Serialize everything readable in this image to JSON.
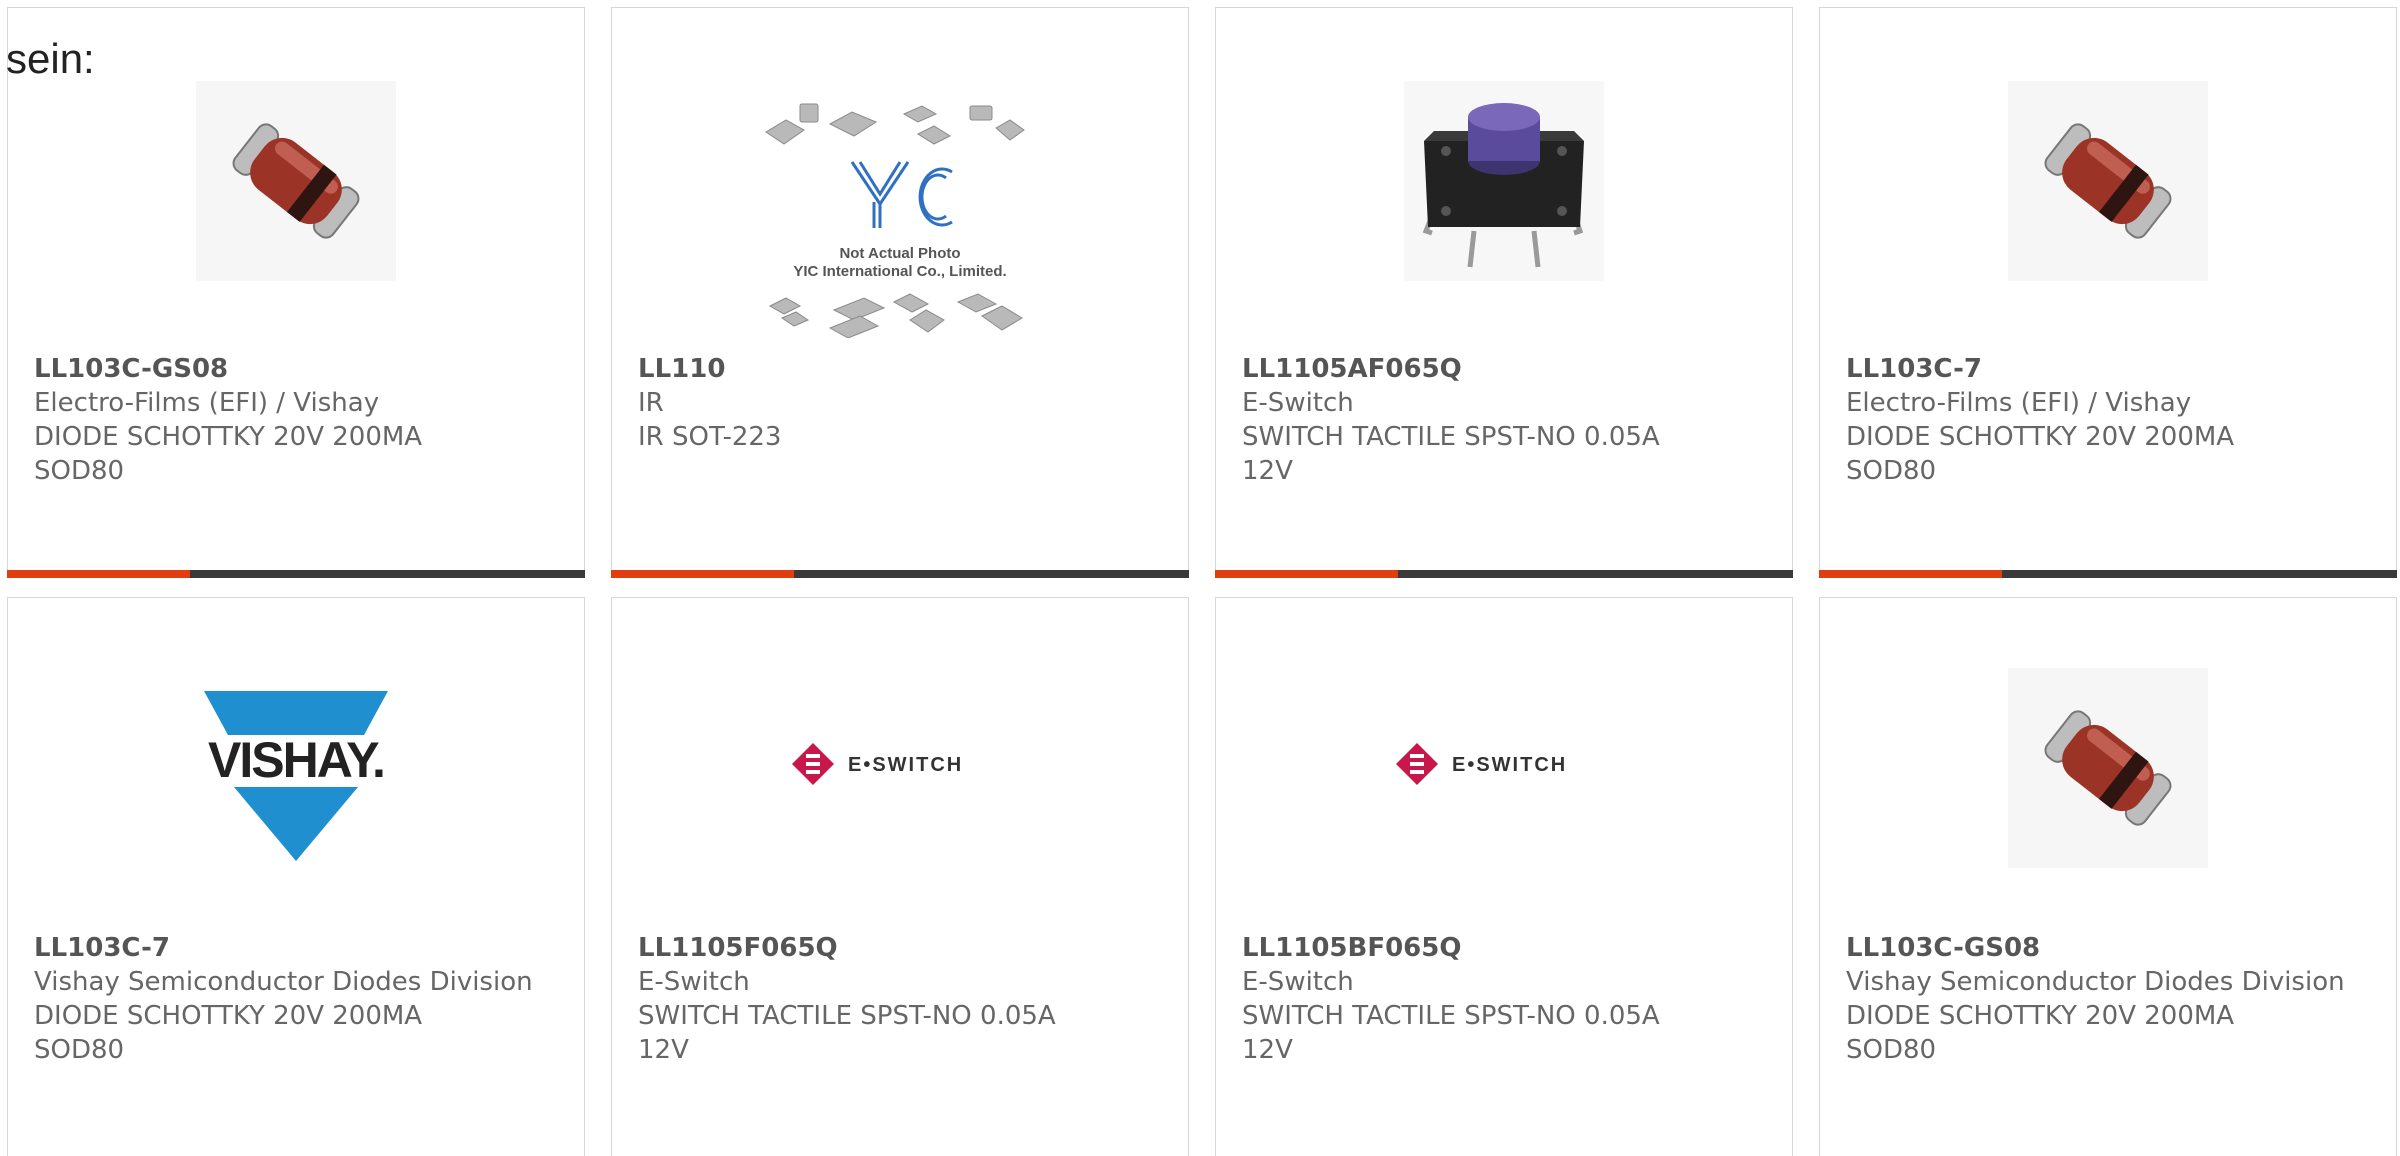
{
  "intro_text": "sein:",
  "colors": {
    "accent": "#e23d0f",
    "bar": "#3a3a3a",
    "text": "#666666"
  },
  "products": [
    {
      "part": "LL103C-GS08",
      "manufacturer": "Electro-Films (EFI) / Vishay",
      "description": "DIODE SCHOTTKY 20V 200MA SOD80",
      "image": "diode-photo"
    },
    {
      "part": "LL110",
      "manufacturer": "IR",
      "description": "IR SOT-223",
      "image": "yic-placeholder",
      "image_caption_1": "Not Actual Photo",
      "image_caption_2": "YIC International Co., Limited."
    },
    {
      "part": "LL1105AF065Q",
      "manufacturer": "E-Switch",
      "description": "SWITCH TACTILE SPST-NO 0.05A 12V",
      "image": "tactile-switch-photo"
    },
    {
      "part": "LL103C-7",
      "manufacturer": "Electro-Films (EFI) / Vishay",
      "description": "DIODE SCHOTTKY 20V 200MA SOD80",
      "image": "diode-photo"
    },
    {
      "part": "LL103C-7",
      "manufacturer": "Vishay Semiconductor Diodes Division",
      "description": "DIODE SCHOTTKY 20V 200MA SOD80",
      "image": "vishay-logo",
      "logo_text": "VISHAY."
    },
    {
      "part": "LL1105F065Q",
      "manufacturer": "E-Switch",
      "description": "SWITCH TACTILE SPST-NO 0.05A 12V",
      "image": "e-switch-logo",
      "logo_text": "E•SWITCH"
    },
    {
      "part": "LL1105BF065Q",
      "manufacturer": "E-Switch",
      "description": "SWITCH TACTILE SPST-NO 0.05A 12V",
      "image": "e-switch-logo",
      "logo_text": "E•SWITCH"
    },
    {
      "part": "LL103C-GS08",
      "manufacturer": "Vishay Semiconductor Diodes Division",
      "description": "DIODE SCHOTTKY 20V 200MA SOD80",
      "image": "diode-photo"
    }
  ]
}
